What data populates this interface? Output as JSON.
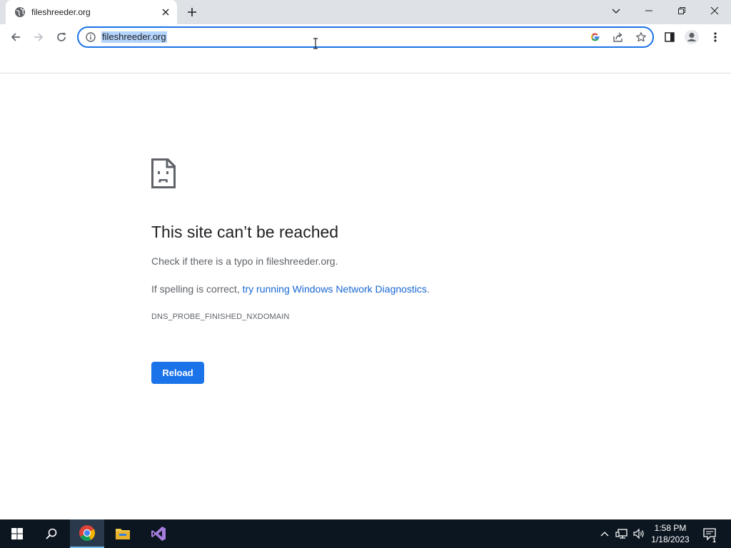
{
  "browser": {
    "tab_title": "fileshreeder.org",
    "url": "fileshreeder.org"
  },
  "error_page": {
    "title": "This site can’t be reached",
    "line1": "Check if there is a typo in fileshreeder.org.",
    "line2_prefix": "If spelling is correct, ",
    "line2_link": "try running Windows Network Diagnostics",
    "line2_suffix": ".",
    "error_code": "DNS_PROBE_FINISHED_NXDOMAIN",
    "reload_label": "Reload"
  },
  "taskbar": {
    "time": "1:58 PM",
    "date": "1/18/2023",
    "notification_count": "1"
  },
  "colors": {
    "accent": "#1a73e8",
    "link": "#1967d2",
    "tabstrip": "#dee1e6",
    "taskbar": "#0c1620"
  },
  "icons": [
    "globe-icon",
    "close-icon",
    "plus-icon",
    "chevron-down-icon",
    "minimize-icon",
    "restore-icon",
    "window-close-icon",
    "back-arrow-icon",
    "forward-arrow-icon",
    "reload-icon",
    "info-icon",
    "google-icon",
    "share-icon",
    "star-icon",
    "side-panel-icon",
    "profile-icon",
    "kebab-menu-icon",
    "sad-page-icon",
    "windows-start-icon",
    "search-icon",
    "chrome-icon",
    "file-explorer-icon",
    "visual-studio-icon",
    "chevron-up-icon",
    "network-icon",
    "volume-icon",
    "notification-icon"
  ]
}
